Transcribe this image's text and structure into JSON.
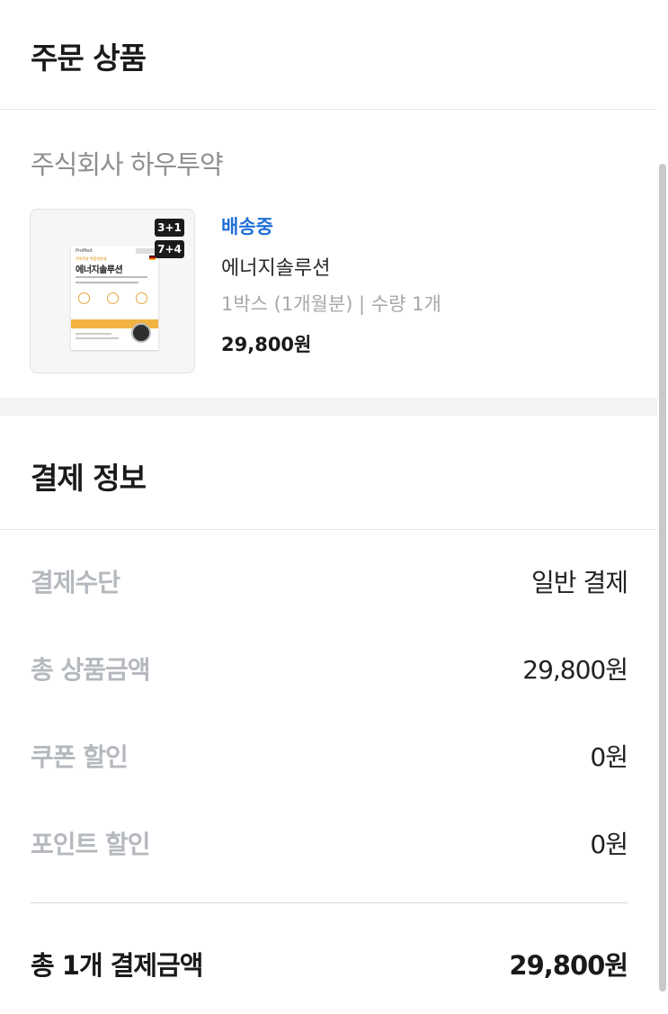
{
  "order_section": {
    "title": "주문 상품",
    "seller": "주식회사 하우투약",
    "item": {
      "badges": [
        "3+1",
        "7+4"
      ],
      "package": {
        "brand": "ProMed",
        "subtitle": "전측학쌍 복합영양제",
        "name": "에너지솔루션"
      },
      "status": "배송중",
      "name": "에너지솔루션",
      "meta": "1박스 (1개월분) | 수량 1개",
      "price": "29,800원"
    }
  },
  "payment_section": {
    "title": "결제 정보",
    "rows": [
      {
        "label": "결제수단",
        "value": "일반 결제"
      },
      {
        "label": "총 상품금액",
        "value": "29,800원"
      },
      {
        "label": "쿠폰 할인",
        "value": "0원"
      },
      {
        "label": "포인트 할인",
        "value": "0원"
      }
    ],
    "total": {
      "label": "총 1개 결제금액",
      "value": "29,800원"
    }
  },
  "colors": {
    "status": "#1f6fd8",
    "label_gray": "#b5b9be",
    "section_gap": "#f2f3f5"
  }
}
